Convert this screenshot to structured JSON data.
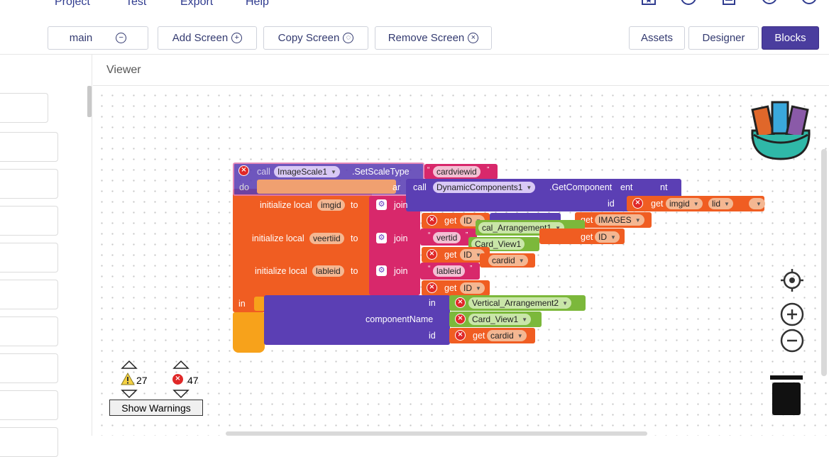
{
  "menu": {
    "items": [
      "Project",
      "Test",
      "Export",
      "Help"
    ]
  },
  "toolbar": {
    "screen": "main",
    "add_screen": "Add Screen",
    "copy_screen": "Copy Screen",
    "remove_screen": "Remove Screen",
    "assets": "Assets",
    "designer": "Designer",
    "blocks": "Blocks"
  },
  "viewer": {
    "title": "Viewer"
  },
  "blocks": {
    "call_label": "call",
    "do_label": "do",
    "ar_label": "ar",
    "image_scale_component": "ImageScale1",
    "set_scale_type": ".SetScaleType",
    "cardviewid_text": "cardviewid",
    "dynamic_component": "DynamicComponents1",
    "get_component": ".GetComponent",
    "nt_label": "nt",
    "ent_label": "ent",
    "id_label": "id",
    "get_label": "get",
    "imgid_var": "imgid",
    "lid_var": "lid",
    "images_var": "IMAGES",
    "id_var": "ID",
    "init_local_label": "initialize local",
    "to_label": "to",
    "join_label": "join",
    "veertiid_var": "veertiid",
    "vertid_text": "vertid",
    "lableid_var": "lableid",
    "lableid_text": "lableid",
    "cal_arrangement_text": "cal_Arrangement1",
    "card_view_partial": "Card_View1",
    "cardid_var": "cardid",
    "in_label": "in",
    "component_name_label": "componentName",
    "vertical_arrangement2": "Vertical_Arrangement2",
    "card_view1": "Card_View1"
  },
  "warnings": {
    "warning_count": "27",
    "error_count": "47",
    "show_warnings": "Show Warnings"
  },
  "colors": {
    "purple_block": "#5b3fb4",
    "orange_block": "#f05d22",
    "text_block": "#d8286b",
    "green_block": "#7cb83b",
    "blocks_active": "#4a3d9e"
  }
}
